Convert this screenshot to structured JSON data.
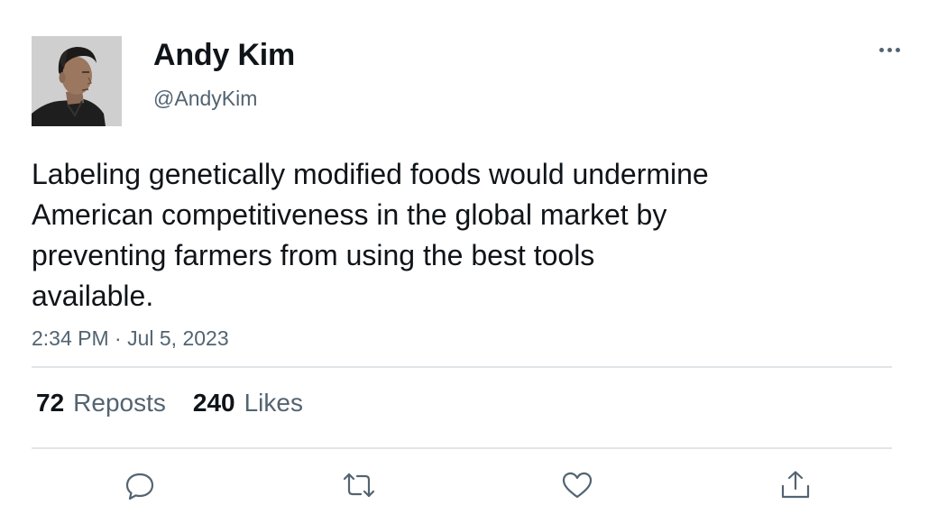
{
  "author": {
    "name": "Andy Kim",
    "handle": "@AndyKim"
  },
  "tweet": {
    "text_lines": [
      "Labeling genetically modified foods would undermine",
      "American competitiveness in the global market by",
      "preventing farmers from using the best tools",
      "available."
    ],
    "timestamp": "2:34 PM · Jul 5, 2023"
  },
  "stats": {
    "reposts_count": "72",
    "reposts_label": "Reposts",
    "likes_count": "240",
    "likes_label": "Likes"
  },
  "actions": [
    "reply-icon",
    "repost-icon",
    "like-icon",
    "share-icon"
  ],
  "colors": {
    "text": "#0f1419",
    "secondary": "#536471",
    "divider": "#e1e5e8"
  }
}
